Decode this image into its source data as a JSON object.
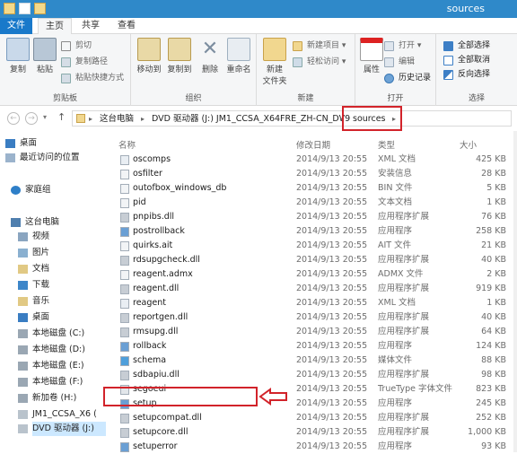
{
  "window": {
    "title": "sources"
  },
  "ribbon_tabs": [
    "文件",
    "主页",
    "共享",
    "查看"
  ],
  "ribbon": {
    "clipboard": {
      "name": "剪贴板",
      "copy": "复制",
      "paste": "粘贴",
      "cut": "剪切",
      "copy_path": "复制路径",
      "paste_shortcut": "粘贴快捷方式"
    },
    "organize": {
      "name": "组织",
      "move_to": "移动到",
      "copy_to": "复制到",
      "delete": "删除",
      "rename": "重命名"
    },
    "new": {
      "name": "新建",
      "new_folder": "新建\n文件夹",
      "new_item": "新建项目 ▾",
      "easy_access": "轻松访问 ▾"
    },
    "open": {
      "name": "打开",
      "properties": "属性",
      "open": "打开 ▾",
      "edit": "编辑",
      "history": "历史记录"
    },
    "select": {
      "name": "选择",
      "select_all": "全部选择",
      "select_none": "全部取消",
      "invert": "反向选择"
    }
  },
  "address": {
    "crumbs": [
      "这台电脑",
      "DVD 驱动器 (J:) JM1_CCSA_X64FRE_ZH-CN_DV9",
      "sources"
    ]
  },
  "nav": {
    "items": [
      "桌面",
      "最近访问的位置",
      "家庭组",
      "这台电脑",
      "视频",
      "图片",
      "文档",
      "下载",
      "音乐",
      "桌面",
      "本地磁盘 (C:)",
      "本地磁盘 (D:)",
      "本地磁盘 (E:)",
      "本地磁盘 (F:)",
      "新加卷 (H:)",
      "JM1_CCSA_X6 (",
      "DVD 驱动器 (J:)"
    ]
  },
  "columns": {
    "name": "名称",
    "date": "修改日期",
    "type": "类型",
    "size": "大小"
  },
  "files": [
    {
      "name": "oscomps",
      "date": "2014/9/13 20:55",
      "type": "XML 文档",
      "size": "425 KB"
    },
    {
      "name": "osfilter",
      "date": "2014/9/13 20:55",
      "type": "安装信息",
      "size": "28 KB"
    },
    {
      "name": "outofbox_windows_db",
      "date": "2014/9/13 20:55",
      "type": "BIN 文件",
      "size": "5 KB"
    },
    {
      "name": "pid",
      "date": "2014/9/13 20:55",
      "type": "文本文档",
      "size": "1 KB"
    },
    {
      "name": "pnpibs.dll",
      "date": "2014/9/13 20:55",
      "type": "应用程序扩展",
      "size": "76 KB"
    },
    {
      "name": "postrollback",
      "date": "2014/9/13 20:55",
      "type": "应用程序",
      "size": "258 KB"
    },
    {
      "name": "quirks.ait",
      "date": "2014/9/13 20:55",
      "type": "AIT 文件",
      "size": "21 KB"
    },
    {
      "name": "rdsupgcheck.dll",
      "date": "2014/9/13 20:55",
      "type": "应用程序扩展",
      "size": "40 KB"
    },
    {
      "name": "reagent.admx",
      "date": "2014/9/13 20:55",
      "type": "ADMX 文件",
      "size": "2 KB"
    },
    {
      "name": "reagent.dll",
      "date": "2014/9/13 20:55",
      "type": "应用程序扩展",
      "size": "919 KB"
    },
    {
      "name": "reagent",
      "date": "2014/9/13 20:55",
      "type": "XML 文档",
      "size": "1 KB"
    },
    {
      "name": "reportgen.dll",
      "date": "2014/9/13 20:55",
      "type": "应用程序扩展",
      "size": "40 KB"
    },
    {
      "name": "rmsupg.dll",
      "date": "2014/9/13 20:55",
      "type": "应用程序扩展",
      "size": "64 KB"
    },
    {
      "name": "rollback",
      "date": "2014/9/13 20:55",
      "type": "应用程序",
      "size": "124 KB"
    },
    {
      "name": "schema",
      "date": "2014/9/13 20:55",
      "type": "媒体文件",
      "size": "88 KB"
    },
    {
      "name": "sdbapiu.dll",
      "date": "2014/9/13 20:55",
      "type": "应用程序扩展",
      "size": "98 KB"
    },
    {
      "name": "segoeui",
      "date": "2014/9/13 20:55",
      "type": "TrueType 字体文件",
      "size": "823 KB"
    },
    {
      "name": "setup",
      "date": "2014/9/13 20:55",
      "type": "应用程序",
      "size": "245 KB"
    },
    {
      "name": "setupcompat.dll",
      "date": "2014/9/13 20:55",
      "type": "应用程序扩展",
      "size": "252 KB"
    },
    {
      "name": "setupcore.dll",
      "date": "2014/9/13 20:55",
      "type": "应用程序扩展",
      "size": "1,000 KB"
    },
    {
      "name": "setuperror",
      "date": "2014/9/13 20:55",
      "type": "应用程序",
      "size": "93 KB"
    }
  ],
  "colors": {
    "title_bar": "#2f89c9",
    "file_tab": "#1979ca",
    "highlight": "#d2232a"
  },
  "icons": {
    "back": "arrow-left-icon",
    "forward": "arrow-right-icon",
    "up": "arrow-up-icon",
    "annotation": "hollow-left-arrow-icon"
  }
}
